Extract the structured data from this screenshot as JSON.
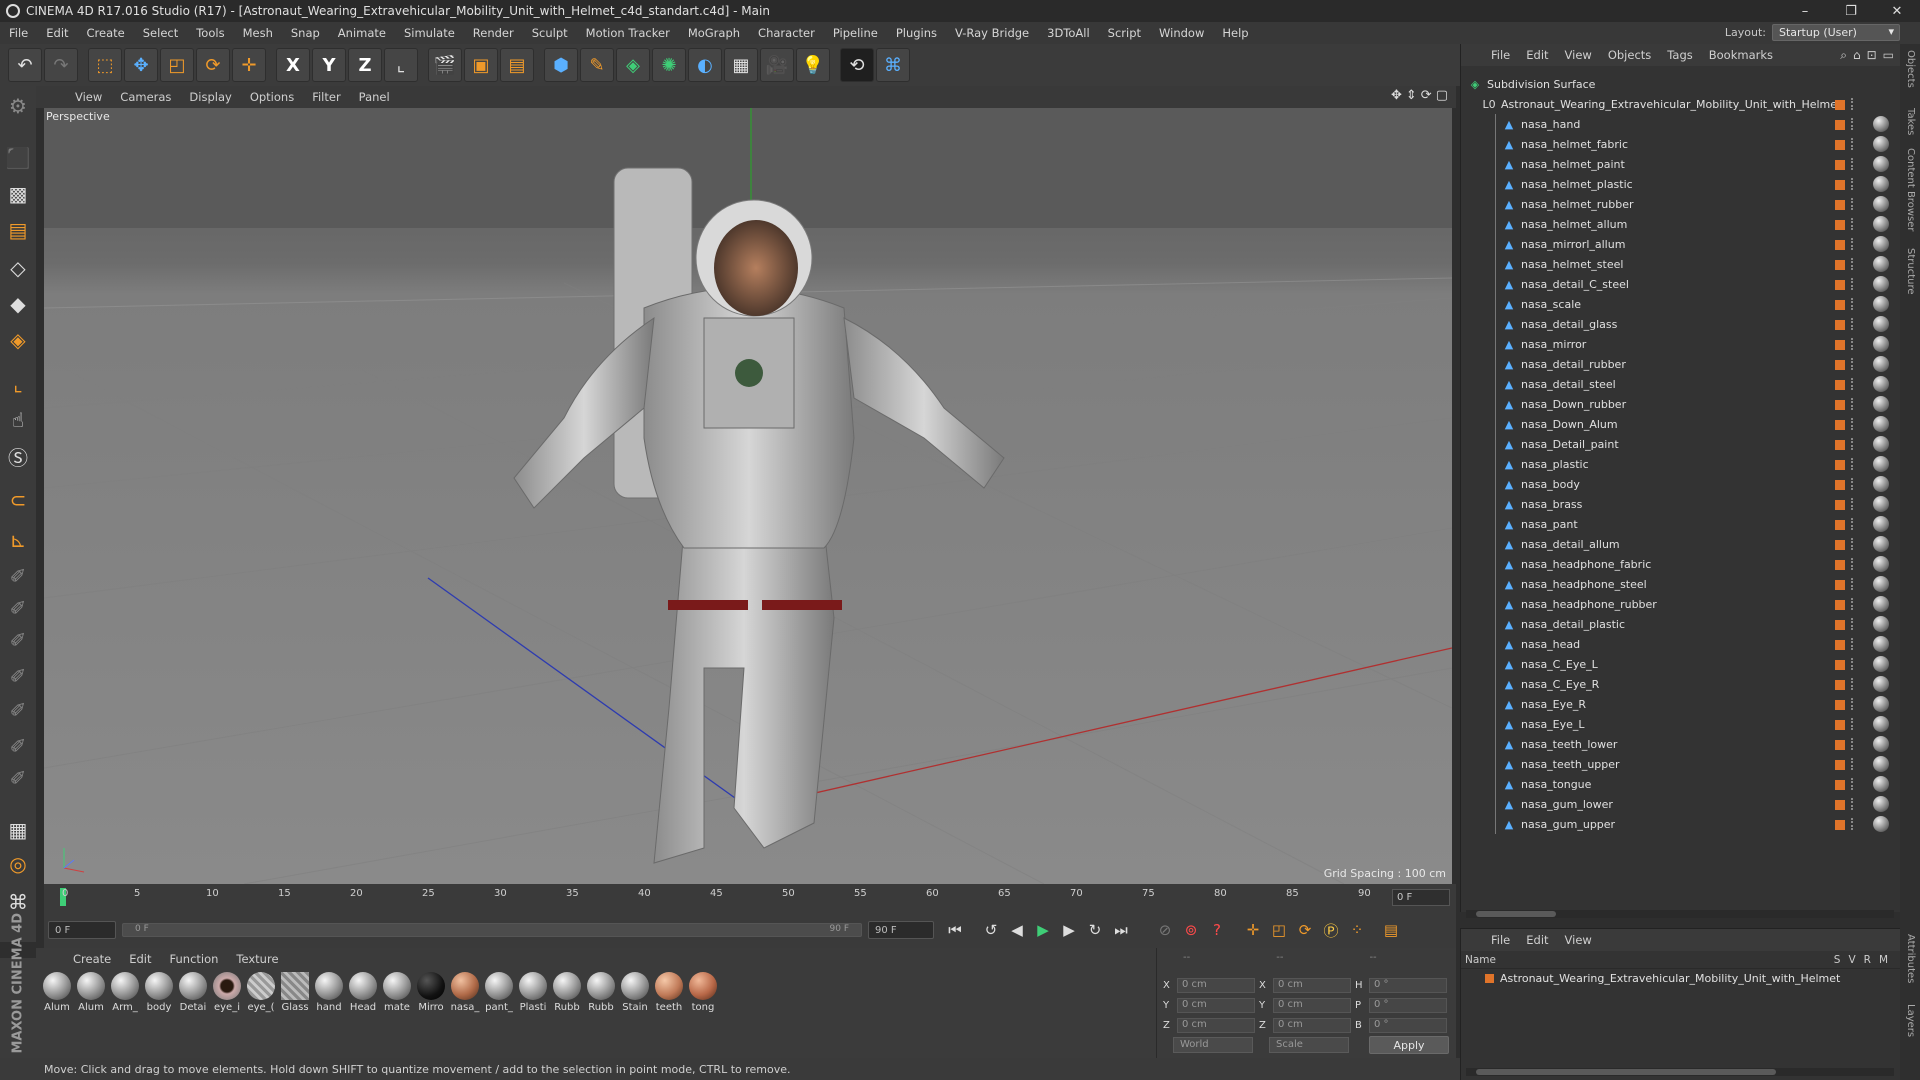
{
  "window": {
    "title": "CINEMA 4D R17.016 Studio (R17) - [Astronaut_Wearing_Extravehicular_Mobility_Unit_with_Helmet_c4d_standart.c4d] - Main",
    "controls": [
      "–",
      "❐",
      "✕"
    ]
  },
  "menubar": {
    "items": [
      "File",
      "Edit",
      "Create",
      "Select",
      "Tools",
      "Mesh",
      "Snap",
      "Animate",
      "Simulate",
      "Render",
      "Sculpt",
      "Motion Tracker",
      "MoGraph",
      "Character",
      "Pipeline",
      "Plugins",
      "V-Ray Bridge",
      "3DToAll",
      "Script",
      "Window",
      "Help"
    ],
    "layout_label": "Layout:",
    "layout_value": "Startup (User)"
  },
  "toolbar": {
    "icons": [
      "undo-icon",
      "redo-icon",
      "select-icon",
      "move-icon",
      "scale-icon",
      "rotate-icon",
      "transform-icon",
      "x-axis-icon",
      "y-axis-icon",
      "z-axis-icon",
      "coordinate-system-icon",
      "render-view-icon",
      "render-picture-viewer-icon",
      "render-settings-icon",
      "cube-icon",
      "pen-icon",
      "subdivision-icon",
      "mograph-cloner-icon",
      "deformer-icon",
      "floor-icon",
      "camera-icon",
      "light-icon",
      "vray-icon",
      "python-icon"
    ],
    "axis_labels": [
      "X",
      "Y",
      "Z"
    ]
  },
  "viewport": {
    "menu": [
      "View",
      "Cameras",
      "Display",
      "Options",
      "Filter",
      "Panel"
    ],
    "label": "Perspective",
    "grid_spacing": "Grid Spacing : 100 cm"
  },
  "timeline": {
    "ticks": [
      "0",
      "5",
      "10",
      "15",
      "20",
      "25",
      "30",
      "35",
      "40",
      "45",
      "50",
      "55",
      "60",
      "65",
      "70",
      "75",
      "80",
      "85",
      "90"
    ],
    "current_frame": "0 F",
    "start_field": "0 F",
    "slider_start": "0 F",
    "slider_end": "90 F",
    "end_field": "90 F"
  },
  "materials": {
    "menu": [
      "Create",
      "Edit",
      "Function",
      "Texture"
    ],
    "items": [
      "Alum",
      "Alum",
      "Arm_",
      "body",
      "Detai",
      "eye_i",
      "eye_(",
      "Glass",
      "hand",
      "Head",
      "mate",
      "Mirro",
      "nasa_",
      "pant_",
      "Plasti",
      "Rubb",
      "Rubb",
      "Stain",
      "teeth",
      "tong"
    ]
  },
  "coordinates": {
    "header": [
      "--",
      "--",
      "--"
    ],
    "rows": [
      {
        "a": "X",
        "v1": "0 cm",
        "b": "X",
        "v2": "0 cm",
        "c": "H",
        "v3": "0 °"
      },
      {
        "a": "Y",
        "v1": "0 cm",
        "b": "Y",
        "v2": "0 cm",
        "c": "P",
        "v3": "0 °"
      },
      {
        "a": "Z",
        "v1": "0 cm",
        "b": "Z",
        "v2": "0 cm",
        "c": "B",
        "v3": "0 °"
      }
    ],
    "mode": "World",
    "scale_mode": "Scale",
    "apply": "Apply"
  },
  "status": "Move: Click and drag to move elements. Hold down SHIFT to quantize movement / add to the selection in point mode, CTRL to remove.",
  "branding": "MAXON CINEMA 4D",
  "objects_panel": {
    "menu": [
      "File",
      "Edit",
      "View",
      "Objects",
      "Tags",
      "Bookmarks"
    ],
    "root": "Subdivision Surface",
    "group": "Astronaut_Wearing_Extravehicular_Mobility_Unit_with_Helmet",
    "children": [
      "nasa_hand",
      "nasa_helmet_fabric",
      "nasa_helmet_paint",
      "nasa_helmet_plastic",
      "nasa_helmet_rubber",
      "nasa_helmet_allum",
      "nasa_mirrorl_allum",
      "nasa_helmet_steel",
      "nasa_detail_C_steel",
      "nasa_scale",
      "nasa_detail_glass",
      "nasa_mirror",
      "nasa_detail_rubber",
      "nasa_detail_steel",
      "nasa_Down_rubber",
      "nasa_Down_Alum",
      "nasa_Detail_paint",
      "nasa_plastic",
      "nasa_body",
      "nasa_brass",
      "nasa_pant",
      "nasa_detail_allum",
      "nasa_headphone_fabric",
      "nasa_headphone_steel",
      "nasa_headphone_rubber",
      "nasa_detail_plastic",
      "nasa_head",
      "nasa_C_Eye_L",
      "nasa_C_Eye_R",
      "nasa_Eye_R",
      "nasa_Eye_L",
      "nasa_teeth_lower",
      "nasa_teeth_upper",
      "nasa_tongue",
      "nasa_gum_lower",
      "nasa_gum_upper"
    ]
  },
  "attributes_panel": {
    "menu": [
      "File",
      "Edit",
      "View"
    ],
    "header_name": "Name",
    "header_cols": [
      "S",
      "V",
      "R",
      "M"
    ],
    "item": "Astronaut_Wearing_Extravehicular_Mobility_Unit_with_Helmet"
  },
  "side_tabs": [
    "Objects",
    "Takes",
    "Content Browser",
    "Structure",
    "Attributes",
    "Layers"
  ],
  "colors": {
    "accent_orange": "#e0742a",
    "play_green": "#3fce77",
    "axis_blue": "#5ab0ff"
  }
}
